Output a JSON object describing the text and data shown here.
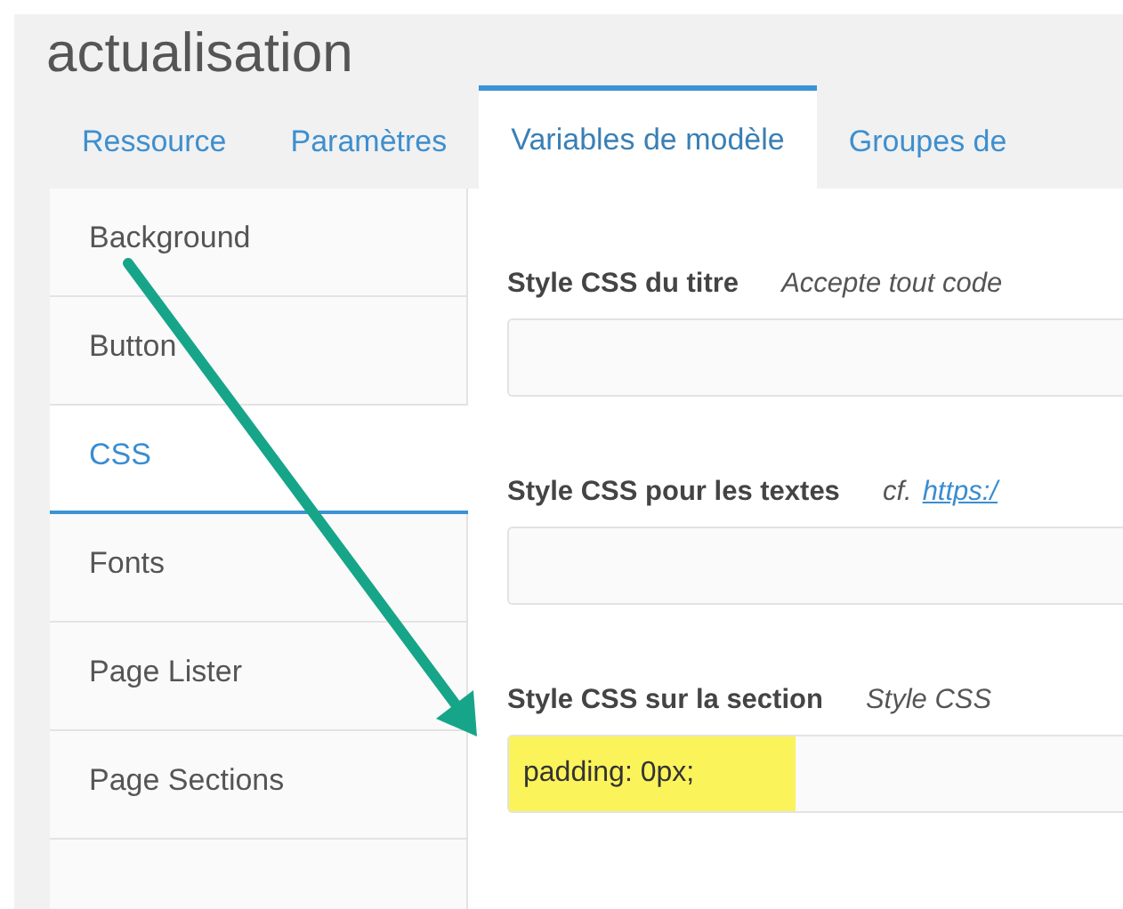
{
  "page_title": "actualisation",
  "tabs": [
    {
      "label": "Ressource",
      "selected": false
    },
    {
      "label": "Paramètres",
      "selected": false
    },
    {
      "label": "Variables de modèle",
      "selected": true
    },
    {
      "label": "Groupes de",
      "selected": false
    }
  ],
  "sidebar": {
    "items": [
      {
        "label": "Background",
        "selected": false
      },
      {
        "label": "Button",
        "selected": false
      },
      {
        "label": "CSS",
        "selected": true
      },
      {
        "label": "Fonts",
        "selected": false
      },
      {
        "label": "Page Lister",
        "selected": false
      },
      {
        "label": "Page Sections",
        "selected": false
      }
    ]
  },
  "fields": [
    {
      "label": "Style CSS du titre",
      "help": "Accepte tout code",
      "kind": "text"
    },
    {
      "label": "Style CSS pour les textes",
      "help_prefix": "cf.",
      "help": "https:/",
      "kind": "link"
    },
    {
      "label": "Style CSS sur la section",
      "help": "Style CSS",
      "kind": "text",
      "value": "padding: 0px;",
      "highlighted": true
    }
  ]
}
